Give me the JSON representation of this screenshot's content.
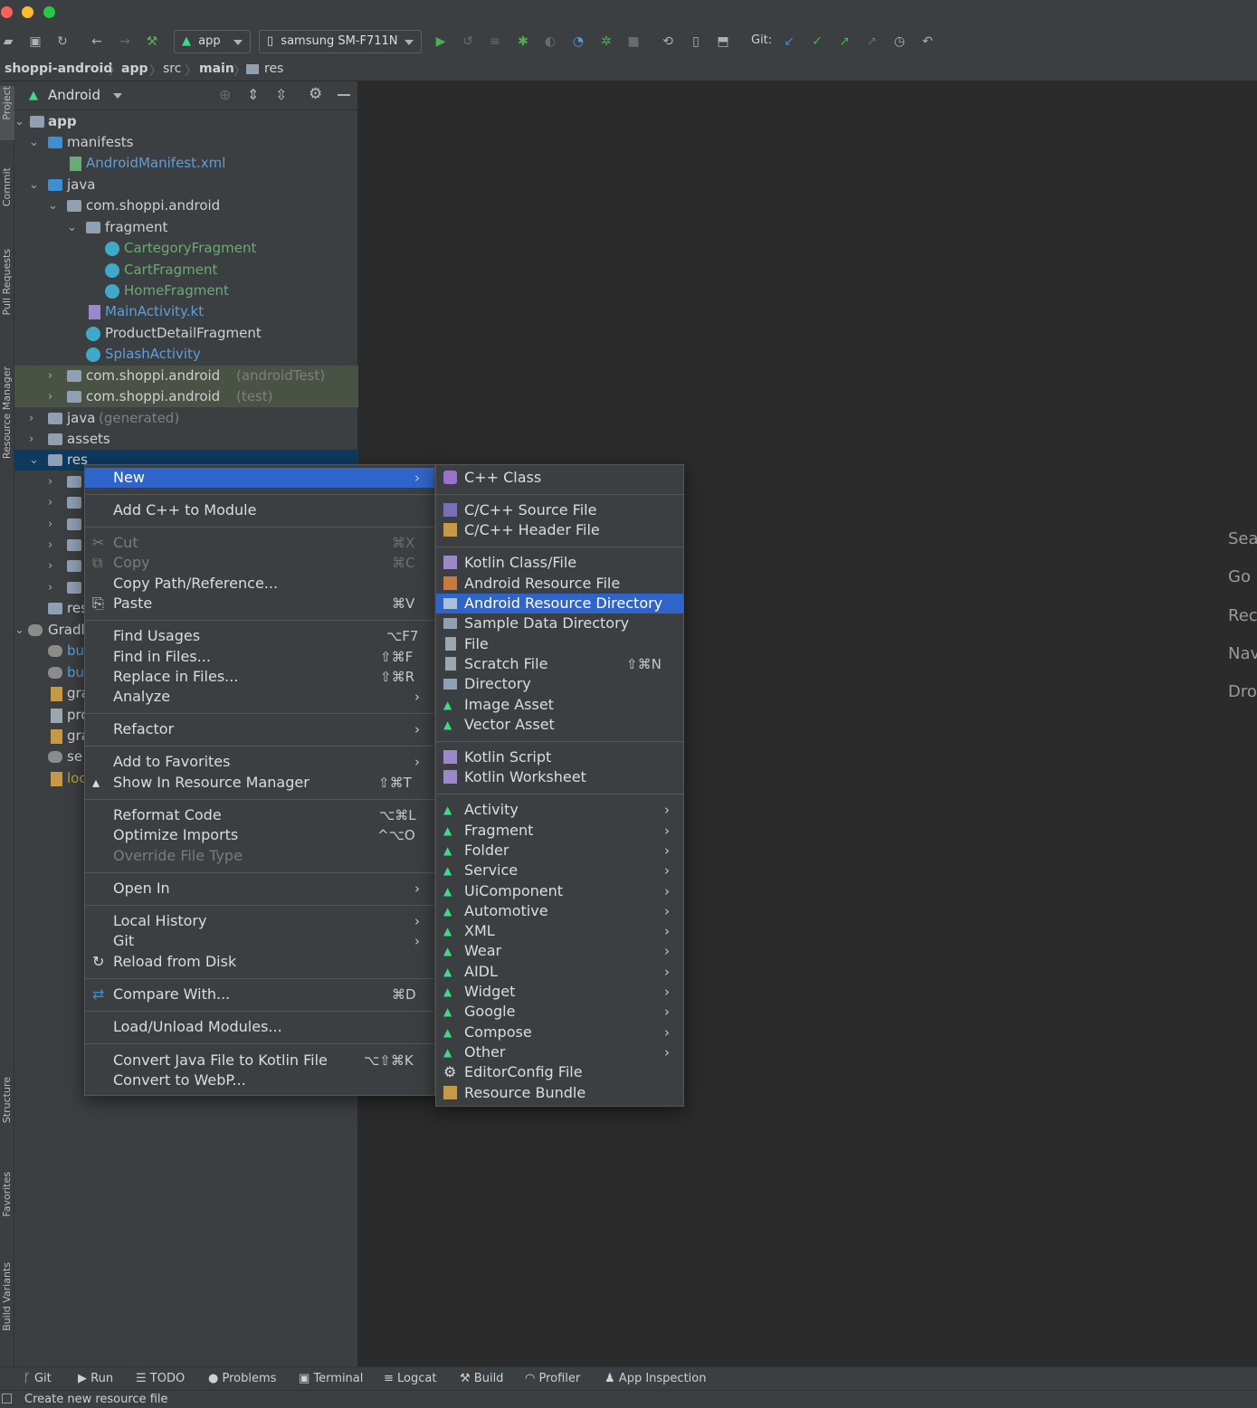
{
  "toolbar": {
    "run_config": "app",
    "device": "samsung SM-F711N",
    "git_label": "Git:"
  },
  "breadcrumb": [
    "shoppi-android",
    "app",
    "src",
    "main",
    "res"
  ],
  "tool_windows_left": [
    "Project",
    "Commit",
    "Pull Requests",
    "Resource Manager",
    "Structure",
    "Favorites",
    "Build Variants"
  ],
  "project": {
    "view_mode": "Android",
    "tree": [
      {
        "label": "app"
      },
      {
        "label": "manifests"
      },
      {
        "label": "AndroidManifest.xml"
      },
      {
        "label": "java"
      },
      {
        "label": "com.shoppi.android"
      },
      {
        "label": "fragment"
      },
      {
        "label": "CartegoryFragment"
      },
      {
        "label": "CartFragment"
      },
      {
        "label": "HomeFragment"
      },
      {
        "label": "MainActivity.kt"
      },
      {
        "label": "ProductDetailFragment"
      },
      {
        "label": "SplashActivity"
      },
      {
        "label": "com.shoppi.android",
        "suffix": "(androidTest)"
      },
      {
        "label": "com.shoppi.android",
        "suffix": "(test)"
      },
      {
        "label": "java",
        "suffix": "(generated)"
      },
      {
        "label": "assets"
      },
      {
        "label": "res"
      },
      {
        "label": "res"
      },
      {
        "label": "Gradl"
      },
      {
        "label": "bu"
      },
      {
        "label": "bu"
      },
      {
        "label": "gra"
      },
      {
        "label": "pro"
      },
      {
        "label": "gra"
      },
      {
        "label": "se"
      },
      {
        "label": "loc"
      }
    ]
  },
  "editor_hints": [
    "Sea",
    "Go",
    "Rec",
    "Nav",
    "Dro"
  ],
  "context_menu": [
    {
      "label": "New",
      "submenu": true
    },
    {
      "label": "Add C++ to Module"
    },
    {
      "label": "Cut",
      "shortcut": "⌘X"
    },
    {
      "label": "Copy",
      "shortcut": "⌘C"
    },
    {
      "label": "Copy Path/Reference..."
    },
    {
      "label": "Paste",
      "shortcut": "⌘V"
    },
    {
      "label": "Find Usages",
      "shortcut": "⌥F7"
    },
    {
      "label": "Find in Files...",
      "shortcut": "⇧⌘F"
    },
    {
      "label": "Replace in Files...",
      "shortcut": "⇧⌘R"
    },
    {
      "label": "Analyze",
      "submenu": true
    },
    {
      "label": "Refactor",
      "submenu": true
    },
    {
      "label": "Add to Favorites",
      "submenu": true
    },
    {
      "label": "Show In Resource Manager",
      "shortcut": "⇧⌘T"
    },
    {
      "label": "Reformat Code",
      "shortcut": "⌥⌘L"
    },
    {
      "label": "Optimize Imports",
      "shortcut": "^⌥O"
    },
    {
      "label": "Override File Type"
    },
    {
      "label": "Open In",
      "submenu": true
    },
    {
      "label": "Local History",
      "submenu": true
    },
    {
      "label": "Git",
      "submenu": true
    },
    {
      "label": "Reload from Disk"
    },
    {
      "label": "Compare With...",
      "shortcut": "⌘D"
    },
    {
      "label": "Load/Unload Modules..."
    },
    {
      "label": "Convert Java File to Kotlin File",
      "shortcut": "⌥⇧⌘K"
    },
    {
      "label": "Convert to WebP..."
    }
  ],
  "new_submenu": [
    {
      "label": "C++ Class"
    },
    {
      "label": "C/C++ Source File"
    },
    {
      "label": "C/C++ Header File"
    },
    {
      "label": "Kotlin Class/File"
    },
    {
      "label": "Android Resource File"
    },
    {
      "label": "Android Resource Directory"
    },
    {
      "label": "Sample Data Directory"
    },
    {
      "label": "File"
    },
    {
      "label": "Scratch File",
      "shortcut": "⇧⌘N"
    },
    {
      "label": "Directory"
    },
    {
      "label": "Image Asset"
    },
    {
      "label": "Vector Asset"
    },
    {
      "label": "Kotlin Script"
    },
    {
      "label": "Kotlin Worksheet"
    },
    {
      "label": "Activity",
      "submenu": true
    },
    {
      "label": "Fragment",
      "submenu": true
    },
    {
      "label": "Folder",
      "submenu": true
    },
    {
      "label": "Service",
      "submenu": true
    },
    {
      "label": "UiComponent",
      "submenu": true
    },
    {
      "label": "Automotive",
      "submenu": true
    },
    {
      "label": "XML",
      "submenu": true
    },
    {
      "label": "Wear",
      "submenu": true
    },
    {
      "label": "AIDL",
      "submenu": true
    },
    {
      "label": "Widget",
      "submenu": true
    },
    {
      "label": "Google",
      "submenu": true
    },
    {
      "label": "Compose",
      "submenu": true
    },
    {
      "label": "Other",
      "submenu": true
    },
    {
      "label": "EditorConfig File"
    },
    {
      "label": "Resource Bundle"
    }
  ],
  "bottom_tools": [
    "Git",
    "Run",
    "TODO",
    "Problems",
    "Terminal",
    "Logcat",
    "Build",
    "Profiler",
    "App Inspection"
  ],
  "status": "Create new resource file",
  "colors": {
    "selection": "#2f65ca",
    "panel": "#3c3f41",
    "editor": "#2b2b2b",
    "android_green": "#3ddc84"
  }
}
